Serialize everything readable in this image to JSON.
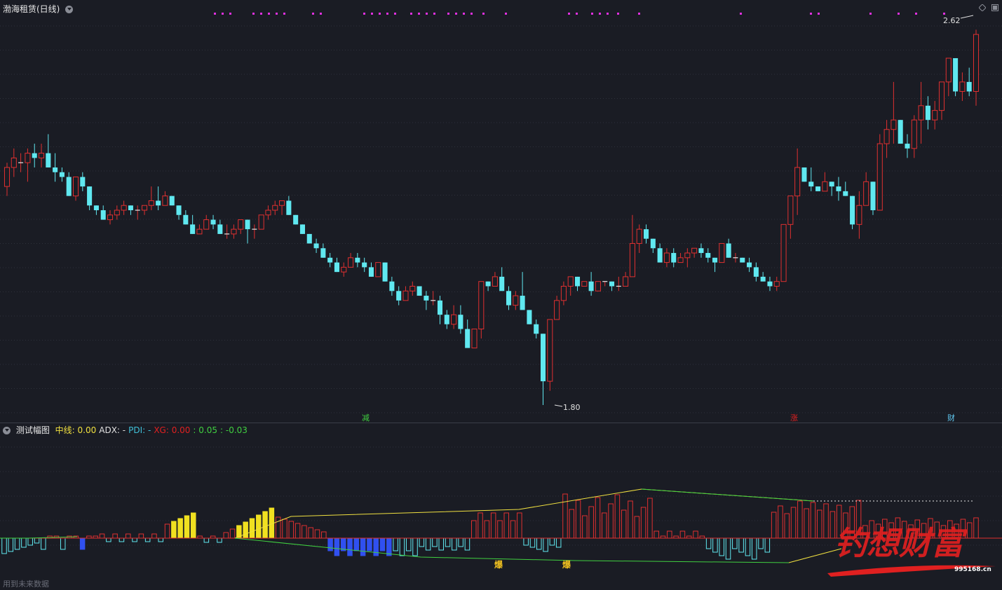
{
  "header": {
    "title": "渤海租赁(日线)"
  },
  "indicator_header": {
    "name": "测试幅图",
    "items": [
      {
        "label": "中线: 0.00",
        "color": "#f0e040"
      },
      {
        "label": "ADX: -",
        "color": "#e0e0e0"
      },
      {
        "label": "PDI: -",
        "color": "#40c0d8"
      },
      {
        "label": "XG: 0.00",
        "color": "#e02020"
      },
      {
        "label": ": 0.05",
        "color": "#40d040"
      },
      {
        "label": ": -0.03",
        "color": "#40d040"
      }
    ]
  },
  "annotations": {
    "high_label": "2.62",
    "low_label": "1.80",
    "signal_1": "减",
    "signal_2": "涨",
    "signal_3": "财",
    "burst_1": "爆",
    "burst_2": "爆",
    "watermark_text": "钓想财富",
    "watermark_url": "995168.cn",
    "footer_text": "用到未来数据"
  },
  "colors": {
    "background": "#1a1c24",
    "up": "#e03030",
    "down": "#60e8f0",
    "grid": "#2e313b",
    "magenta": "#e030e0"
  },
  "chart_data": [
    {
      "type": "candlestick",
      "title": "渤海租赁(日线)",
      "price_range": [
        1.8,
        2.62
      ],
      "candles_ohlc": [
        [
          2.26,
          2.31,
          2.24,
          2.3
        ],
        [
          2.3,
          2.34,
          2.28,
          2.32
        ],
        [
          2.31,
          2.33,
          2.29,
          2.31
        ],
        [
          2.31,
          2.34,
          2.27,
          2.33
        ],
        [
          2.33,
          2.35,
          2.3,
          2.32
        ],
        [
          2.32,
          2.35,
          2.3,
          2.33
        ],
        [
          2.33,
          2.37,
          2.3,
          2.3
        ],
        [
          2.3,
          2.33,
          2.27,
          2.29
        ],
        [
          2.29,
          2.3,
          2.27,
          2.28
        ],
        [
          2.28,
          2.29,
          2.24,
          2.24
        ],
        [
          2.24,
          2.28,
          2.23,
          2.28
        ],
        [
          2.28,
          2.29,
          2.25,
          2.26
        ],
        [
          2.26,
          2.26,
          2.21,
          2.22
        ],
        [
          2.22,
          2.22,
          2.2,
          2.21
        ],
        [
          2.21,
          2.22,
          2.19,
          2.19
        ],
        [
          2.19,
          2.21,
          2.18,
          2.2
        ],
        [
          2.2,
          2.22,
          2.19,
          2.21
        ],
        [
          2.21,
          2.23,
          2.2,
          2.22
        ],
        [
          2.22,
          2.22,
          2.2,
          2.21
        ],
        [
          2.21,
          2.22,
          2.19,
          2.21
        ],
        [
          2.21,
          2.22,
          2.2,
          2.22
        ],
        [
          2.22,
          2.26,
          2.21,
          2.23
        ],
        [
          2.23,
          2.26,
          2.21,
          2.22
        ],
        [
          2.22,
          2.25,
          2.22,
          2.24
        ],
        [
          2.24,
          2.24,
          2.22,
          2.22
        ],
        [
          2.22,
          2.22,
          2.19,
          2.2
        ],
        [
          2.2,
          2.21,
          2.18,
          2.18
        ],
        [
          2.18,
          2.2,
          2.16,
          2.16
        ],
        [
          2.16,
          2.18,
          2.16,
          2.17
        ],
        [
          2.17,
          2.2,
          2.17,
          2.19
        ],
        [
          2.19,
          2.2,
          2.17,
          2.18
        ],
        [
          2.18,
          2.19,
          2.16,
          2.16
        ],
        [
          2.16,
          2.18,
          2.15,
          2.16
        ],
        [
          2.16,
          2.18,
          2.15,
          2.17
        ],
        [
          2.17,
          2.19,
          2.16,
          2.19
        ],
        [
          2.19,
          2.19,
          2.14,
          2.17
        ],
        [
          2.17,
          2.18,
          2.15,
          2.17
        ],
        [
          2.17,
          2.2,
          2.17,
          2.2
        ],
        [
          2.2,
          2.22,
          2.19,
          2.21
        ],
        [
          2.21,
          2.23,
          2.2,
          2.22
        ],
        [
          2.22,
          2.23,
          2.2,
          2.23
        ],
        [
          2.23,
          2.24,
          2.2,
          2.2
        ],
        [
          2.2,
          2.2,
          2.18,
          2.18
        ],
        [
          2.18,
          2.18,
          2.16,
          2.16
        ],
        [
          2.16,
          2.16,
          2.14,
          2.14
        ],
        [
          2.14,
          2.15,
          2.12,
          2.13
        ],
        [
          2.13,
          2.14,
          2.11,
          2.11
        ],
        [
          2.11,
          2.12,
          2.09,
          2.1
        ],
        [
          2.1,
          2.11,
          2.08,
          2.08
        ],
        [
          2.08,
          2.1,
          2.07,
          2.09
        ],
        [
          2.09,
          2.12,
          2.09,
          2.11
        ],
        [
          2.11,
          2.12,
          2.09,
          2.1
        ],
        [
          2.1,
          2.11,
          2.08,
          2.09
        ],
        [
          2.09,
          2.1,
          2.07,
          2.07
        ],
        [
          2.07,
          2.1,
          2.07,
          2.1
        ],
        [
          2.1,
          2.1,
          2.06,
          2.06
        ],
        [
          2.06,
          2.07,
          2.03,
          2.04
        ],
        [
          2.04,
          2.05,
          2.01,
          2.02
        ],
        [
          2.02,
          2.05,
          2.02,
          2.04
        ],
        [
          2.04,
          2.06,
          2.03,
          2.05
        ],
        [
          2.05,
          2.05,
          2.03,
          2.03
        ],
        [
          2.03,
          2.04,
          2.0,
          2.02
        ],
        [
          2.02,
          2.04,
          2.01,
          2.02
        ],
        [
          2.02,
          2.03,
          1.97,
          1.99
        ],
        [
          1.99,
          2.0,
          1.96,
          1.97
        ],
        [
          1.97,
          2.01,
          1.96,
          1.99
        ],
        [
          1.99,
          2.01,
          1.95,
          1.96
        ],
        [
          1.96,
          1.98,
          1.95,
          1.92
        ],
        [
          1.92,
          1.96,
          1.92,
          1.96
        ],
        [
          1.96,
          2.06,
          1.94,
          2.06
        ],
        [
          2.06,
          2.06,
          2.04,
          2.05
        ],
        [
          2.05,
          2.08,
          2.05,
          2.07
        ],
        [
          2.07,
          2.09,
          2.06,
          2.04
        ],
        [
          2.04,
          2.05,
          2.0,
          2.01
        ],
        [
          2.01,
          2.04,
          2.0,
          2.03
        ],
        [
          2.03,
          2.08,
          2.02,
          2.0
        ],
        [
          2.0,
          2.0,
          1.97,
          1.97
        ],
        [
          1.97,
          1.98,
          1.94,
          1.95
        ],
        [
          1.95,
          1.95,
          1.8,
          1.85
        ],
        [
          1.85,
          1.98,
          1.83,
          1.98
        ],
        [
          1.98,
          2.03,
          1.98,
          2.02
        ],
        [
          2.02,
          2.06,
          2.01,
          2.05
        ],
        [
          2.05,
          2.07,
          2.03,
          2.07
        ],
        [
          2.07,
          2.07,
          2.04,
          2.05
        ],
        [
          2.05,
          2.06,
          2.05,
          2.06
        ],
        [
          2.06,
          2.08,
          2.03,
          2.04
        ],
        [
          2.04,
          2.06,
          2.04,
          2.06
        ],
        [
          2.06,
          2.06,
          2.05,
          2.06
        ],
        [
          2.06,
          2.06,
          2.04,
          2.05
        ],
        [
          2.05,
          2.07,
          2.04,
          2.05
        ],
        [
          2.05,
          2.08,
          2.05,
          2.07
        ],
        [
          2.07,
          2.2,
          2.07,
          2.14
        ],
        [
          2.14,
          2.18,
          2.12,
          2.17
        ],
        [
          2.17,
          2.18,
          2.14,
          2.15
        ],
        [
          2.15,
          2.15,
          2.12,
          2.13
        ],
        [
          2.13,
          2.14,
          2.1,
          2.1
        ],
        [
          2.1,
          2.13,
          2.09,
          2.12
        ],
        [
          2.12,
          2.13,
          2.09,
          2.1
        ],
        [
          2.1,
          2.12,
          2.1,
          2.11
        ],
        [
          2.11,
          2.13,
          2.09,
          2.12
        ],
        [
          2.12,
          2.13,
          2.11,
          2.13
        ],
        [
          2.13,
          2.14,
          2.11,
          2.12
        ],
        [
          2.12,
          2.13,
          2.1,
          2.11
        ],
        [
          2.11,
          2.11,
          2.08,
          2.1
        ],
        [
          2.1,
          2.14,
          2.1,
          2.14
        ],
        [
          2.14,
          2.15,
          2.11,
          2.11
        ],
        [
          2.11,
          2.12,
          2.1,
          2.11
        ],
        [
          2.11,
          2.11,
          2.1,
          2.1
        ],
        [
          2.1,
          2.11,
          2.08,
          2.09
        ],
        [
          2.09,
          2.1,
          2.06,
          2.07
        ],
        [
          2.07,
          2.08,
          2.06,
          2.06
        ],
        [
          2.06,
          2.07,
          2.04,
          2.05
        ],
        [
          2.05,
          2.07,
          2.04,
          2.06
        ],
        [
          2.06,
          2.18,
          2.06,
          2.18
        ],
        [
          2.18,
          2.23,
          2.15,
          2.24
        ],
        [
          2.24,
          2.34,
          2.2,
          2.3
        ],
        [
          2.3,
          2.3,
          2.27,
          2.27
        ],
        [
          2.27,
          2.3,
          2.25,
          2.26
        ],
        [
          2.26,
          2.26,
          2.25,
          2.25
        ],
        [
          2.25,
          2.29,
          2.25,
          2.27
        ],
        [
          2.27,
          2.27,
          2.24,
          2.26
        ],
        [
          2.26,
          2.28,
          2.23,
          2.25
        ],
        [
          2.25,
          2.27,
          2.24,
          2.24
        ],
        [
          2.24,
          2.24,
          2.17,
          2.18
        ],
        [
          2.18,
          2.25,
          2.15,
          2.22
        ],
        [
          2.22,
          2.29,
          2.22,
          2.27
        ],
        [
          2.27,
          2.27,
          2.2,
          2.21
        ],
        [
          2.21,
          2.37,
          2.21,
          2.35
        ],
        [
          2.35,
          2.4,
          2.32,
          2.38
        ],
        [
          2.38,
          2.48,
          2.35,
          2.4
        ],
        [
          2.4,
          2.4,
          2.35,
          2.35
        ],
        [
          2.35,
          2.37,
          2.32,
          2.34
        ],
        [
          2.34,
          2.41,
          2.32,
          2.4
        ],
        [
          2.4,
          2.48,
          2.35,
          2.43
        ],
        [
          2.43,
          2.45,
          2.38,
          2.4
        ],
        [
          2.4,
          2.44,
          2.38,
          2.42
        ],
        [
          2.42,
          2.47,
          2.4,
          2.48
        ],
        [
          2.48,
          2.53,
          2.45,
          2.53
        ],
        [
          2.53,
          2.53,
          2.45,
          2.46
        ],
        [
          2.46,
          2.5,
          2.44,
          2.48
        ],
        [
          2.48,
          2.51,
          2.45,
          2.46
        ],
        [
          2.46,
          2.59,
          2.43,
          2.58
        ]
      ],
      "signal_markers": [
        {
          "index": 47,
          "label": "减"
        },
        {
          "index": 115,
          "label": "涨"
        },
        {
          "index": 140,
          "label": "财"
        }
      ]
    },
    {
      "type": "bar",
      "title": "测试幅图",
      "series": [
        {
          "name": "中线",
          "values": [
            0.0
          ]
        },
        {
          "name": "XG",
          "values": [
            0.0
          ]
        }
      ]
    }
  ]
}
